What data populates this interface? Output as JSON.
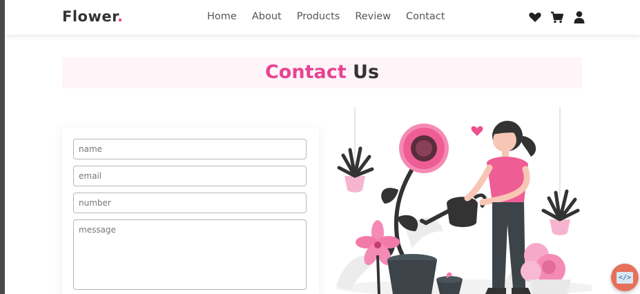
{
  "header": {
    "logo_text": "Flower",
    "logo_dot": ".",
    "nav": [
      "Home",
      "About",
      "Products",
      "Review",
      "Contact"
    ],
    "icons": [
      "heart-icon",
      "cart-icon",
      "user-icon"
    ]
  },
  "heading": {
    "accent": "Contact",
    "rest": "Us"
  },
  "form": {
    "name_placeholder": "name",
    "email_placeholder": "email",
    "number_placeholder": "number",
    "message_placeholder": "message"
  },
  "fab": {
    "label": "</>"
  },
  "colors": {
    "accent": "#e84393",
    "text": "#333333",
    "heading_band": "#fff4f8"
  }
}
